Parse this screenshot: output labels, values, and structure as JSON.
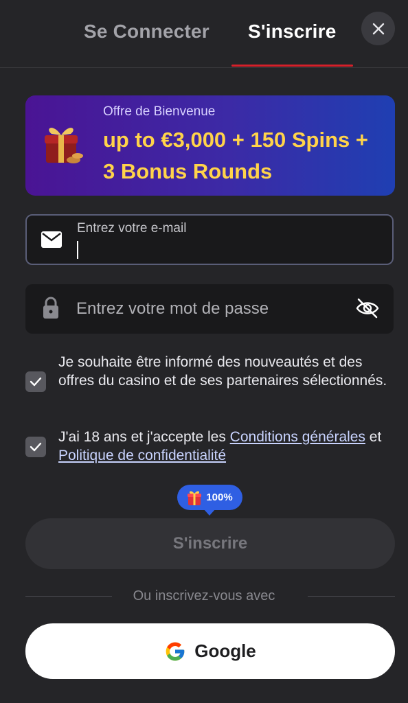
{
  "tabs": {
    "login_label": "Se Connecter",
    "signup_label": "S'inscrire"
  },
  "banner": {
    "subtitle": "Offre de Bienvenue",
    "title": "up to €3,000 + 150 Spins + 3 Bonus Rounds"
  },
  "email": {
    "label": "Entrez votre e-mail",
    "value": ""
  },
  "password": {
    "placeholder": "Entrez votre mot de passe"
  },
  "consents": {
    "newsletter": {
      "checked": true,
      "text": "Je souhaite être informé des nouveautés et des offres du casino et de ses partenaires sélectionnés."
    },
    "terms": {
      "checked": true,
      "prefix": "J'ai 18 ans et j'accepte les ",
      "terms_link": "Conditions générales",
      "joiner": " et ",
      "privacy_link": "Politique de confidentialité"
    }
  },
  "bonus_badge": {
    "value": "100%"
  },
  "submit": {
    "label": "S'inscrire"
  },
  "alt_signup": {
    "divider_text": "Ou inscrivez-vous avec",
    "google_label": "Google"
  },
  "icons": {
    "close": "close-icon",
    "gift": "gift-icon",
    "email": "envelope-icon",
    "password": "lock-icon",
    "visibility": "eye-off-icon",
    "checkbox": "checkmark-icon",
    "google": "google-logo-icon"
  },
  "colors": {
    "accent_red": "#d6202a",
    "banner_highlight": "#ffd34a",
    "badge_blue": "#2f5fe3"
  }
}
